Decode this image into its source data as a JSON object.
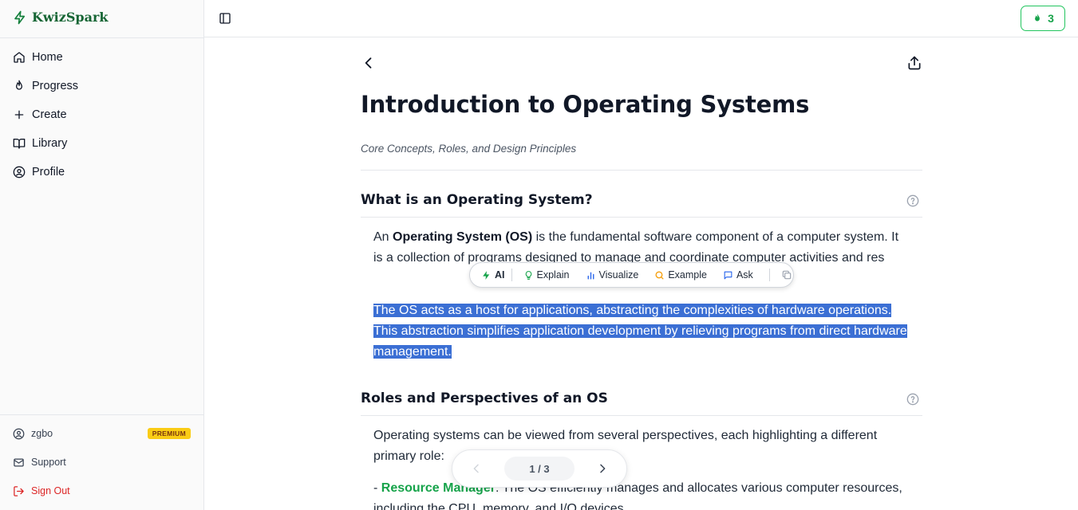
{
  "brand": {
    "name": "KwizSpark"
  },
  "sidebar": {
    "items": [
      {
        "label": "Home",
        "icon": "home-icon"
      },
      {
        "label": "Progress",
        "icon": "flame-icon"
      },
      {
        "label": "Create",
        "icon": "plus-icon"
      },
      {
        "label": "Library",
        "icon": "book-open-icon"
      },
      {
        "label": "Profile",
        "icon": "user-circle-icon"
      }
    ],
    "user": {
      "name": "zgbo",
      "badge": "PREMIUM"
    },
    "support": "Support",
    "signout": "Sign Out"
  },
  "header": {
    "streak_count": "3"
  },
  "lesson": {
    "title": "Introduction to Operating Systems",
    "subtitle": "Core Concepts, Roles, and Design Principles",
    "sections": [
      {
        "heading": "What is an Operating System?",
        "p1_pre": "An ",
        "p1_bold": "Operating System (OS)",
        "p1_post": " is the fundamental software component of a computer system. It is a collection of programs designed to manage and coordinate computer activities and res",
        "p2": "The OS acts as a host for applications, abstracting the complexities of hardware operations. This abstraction simplifies application development by relieving programs from direct hardware management."
      },
      {
        "heading": "Roles and Perspectives of an OS",
        "p1": "Operating systems can be viewed from several perspectives, each highlighting a different primary role:",
        "bullet_prefix": "- ",
        "bullet_term": "Resource Manager",
        "bullet_text": ": The OS efficiently manages and allocates various computer resources, including the CPU, memory, and I/O devices."
      }
    ]
  },
  "toolbar": {
    "ai": "AI",
    "explain": "Explain",
    "visualize": "Visualize",
    "example": "Example",
    "ask": "Ask"
  },
  "pager": {
    "indicator": "1 / 3"
  },
  "colors": {
    "accent": "#16a34a",
    "selection": "#3b6fd4",
    "brand": "#166534"
  }
}
